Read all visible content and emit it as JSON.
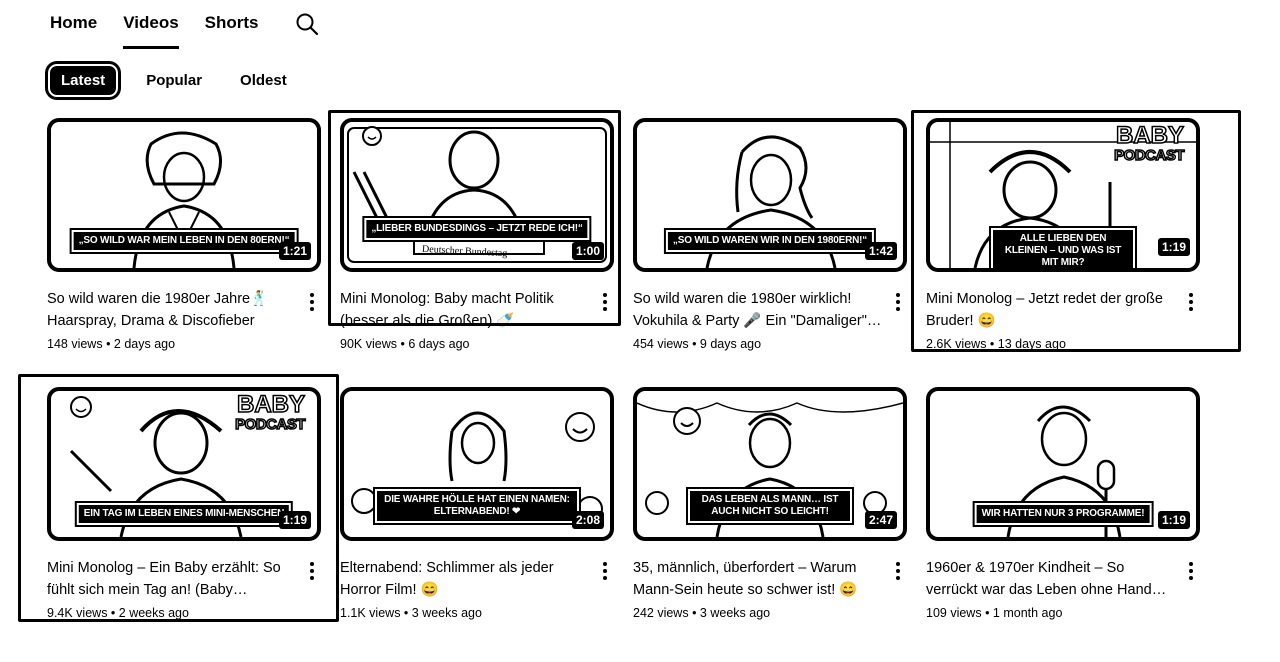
{
  "nav": {
    "tabs": [
      "Home",
      "Videos",
      "Shorts"
    ],
    "active_tab": "Videos",
    "search_icon": "search-icon"
  },
  "filters": {
    "chips": [
      "Latest",
      "Popular",
      "Oldest"
    ],
    "active": "Latest"
  },
  "videos": [
    {
      "title": "So wild waren die 1980er Jahre🕺 Haarspray, Drama & Discofieber",
      "duration": "1:21",
      "caption": "„So wild war mein Leben in den 80ern!“",
      "views": "148 views",
      "age": "2 days ago"
    },
    {
      "title": "Mini Monolog: Baby macht Politik (besser als die Großen) 🍼",
      "duration": "1:00",
      "caption": "„Lieber Bundesdings – jetzt rede ich!“",
      "views": "90K views",
      "age": "6 days ago",
      "sign": "Deutscher Bundestag"
    },
    {
      "title": "So wild waren die 1980er wirklich! Vokuhila & Party 🎤 Ein \"Damaliger\"…",
      "duration": "1:42",
      "caption": "„So wild waren wir in den 1980ern!“",
      "views": "454 views",
      "age": "9 days ago"
    },
    {
      "title": "Mini Monolog – Jetzt redet der große Bruder! 😄",
      "duration": "1:19",
      "caption": "Alle lieben den Kleinen – und was ist mit mir?",
      "views": "2.6K views",
      "age": "13 days ago",
      "logo": [
        "BABY",
        "PODCAST"
      ]
    },
    {
      "title": "Mini Monolog – Ein Baby erzählt: So fühlt sich mein Tag an! (Baby…",
      "duration": "1:19",
      "caption": "Ein Tag im Leben eines Mini-Menschen",
      "views": "9.4K views",
      "age": "2 weeks ago",
      "logo": [
        "BABY",
        "PODCAST"
      ]
    },
    {
      "title": "Elternabend: Schlimmer als jeder Horror Film! 😄",
      "duration": "2:08",
      "caption": "Die wahre Hölle hat einen Namen: Elternabend! ❤",
      "views": "1.1K views",
      "age": "3 weeks ago"
    },
    {
      "title": "35, männlich, überfordert – Warum Mann-Sein heute so schwer ist! 😄",
      "duration": "2:47",
      "caption": "Das Leben als Mann… ist auch nicht so leicht!",
      "views": "242 views",
      "age": "3 weeks ago"
    },
    {
      "title": "1960er & 1970er Kindheit – So verrückt war das Leben ohne Hand…",
      "duration": "1:19",
      "caption": "Wir hatten nur 3 Programme!",
      "views": "109 views",
      "age": "1 month ago"
    }
  ],
  "ui": {
    "separator": " • "
  }
}
